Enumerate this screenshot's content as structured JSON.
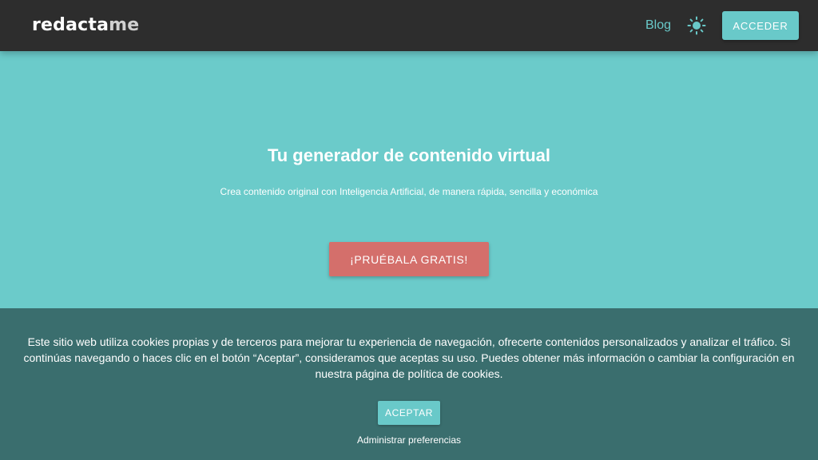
{
  "header": {
    "logo_main": "redacta",
    "logo_accent": "me",
    "nav_blog": "Blog",
    "theme_icon": "sun-icon",
    "login_label": "ACCEDER"
  },
  "hero": {
    "title": "Tu generador de contenido virtual",
    "subtitle": "Crea contenido original con Inteligencia Artificial, de manera rápida, sencilla y económica",
    "cta_label": "¡PRUÉBALA GRATIS!"
  },
  "cookie_banner": {
    "text": "Este sitio web utiliza cookies propias y de terceros para mejorar tu experiencia de navegación, ofrecerte contenidos personalizados y analizar el tráfico. Si continúas navegando o haces clic en el botón “Aceptar”, consideramos que aceptas su uso. Puedes obtener más información o cambiar la configuración en nuestra página de política de cookies.",
    "accept_label": "ACEPTAR",
    "preferences_label": "Administrar preferencias"
  },
  "colors": {
    "header_bg": "#2d2d2d",
    "hero_bg": "#6bcbca",
    "accent": "#69c9c9",
    "cta": "#d46f6b",
    "cookie_bg": "#3a6e6e"
  }
}
